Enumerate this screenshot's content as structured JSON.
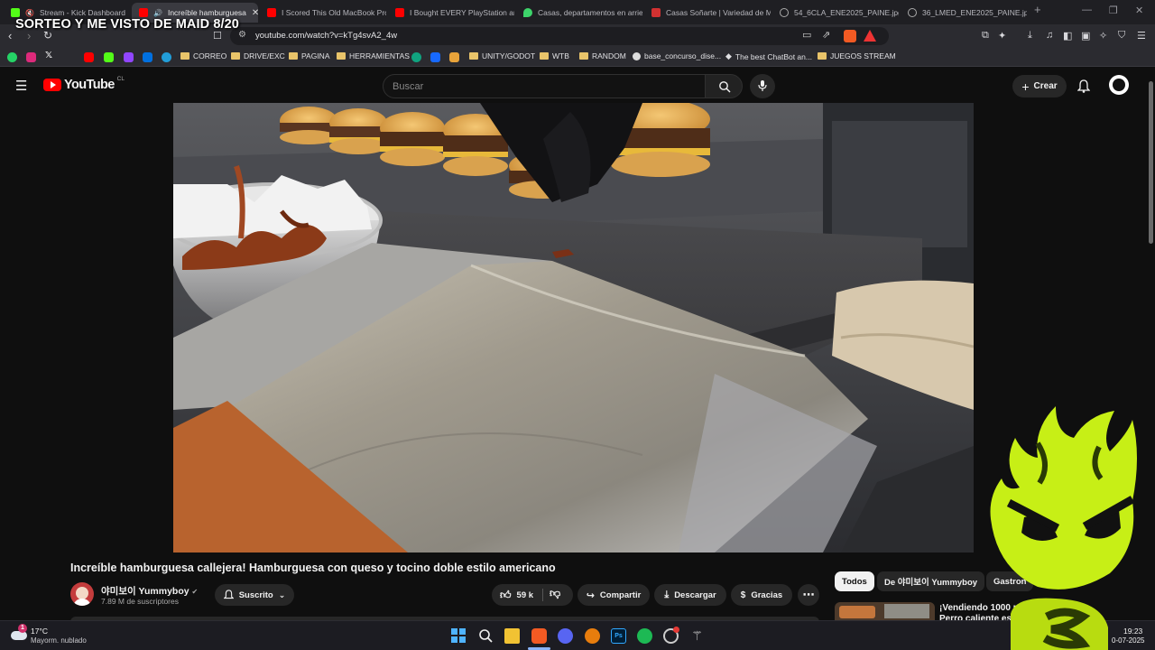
{
  "overlay": {
    "title": "SORTEO Y ME VISTO DE MAID 8/20"
  },
  "tabs": [
    {
      "label": "Stream - Kick Dashboard",
      "color": "#53fc18"
    },
    {
      "label": "Increíble hamburguesa",
      "color": "#ff0000",
      "active": true
    },
    {
      "label": "I Scored This Old MacBook Pro",
      "color": "#ff0000"
    },
    {
      "label": "I Bought EVERY PlayStation and",
      "color": "#ff0000"
    },
    {
      "label": "Casas, departamentos en arrie",
      "color": "#3dd46a"
    },
    {
      "label": "Casas Soñarte | Variedad de M",
      "color": "#d23131"
    },
    {
      "label": "54_6CLA_ENE2025_PAINE.jpg",
      "color": "#9a9aa0"
    },
    {
      "label": "36_LMED_ENE2025_PAINE.jpg",
      "color": "#9a9aa0"
    }
  ],
  "address": {
    "url": "youtube.com/watch?v=kTg4svA2_4w"
  },
  "bookmarks": [
    {
      "label": "CORREO",
      "type": "folder"
    },
    {
      "label": "DRIVE/EXC",
      "type": "folder"
    },
    {
      "label": "PAGINA",
      "type": "folder"
    },
    {
      "label": "HERRAMIENTAS",
      "type": "folder"
    },
    {
      "label": "UNITY/GODOT",
      "type": "folder"
    },
    {
      "label": "WTB",
      "type": "folder"
    },
    {
      "label": "RANDOM",
      "type": "folder"
    },
    {
      "label": "base_concurso_dise...",
      "type": "link"
    },
    {
      "label": "The best ChatBot an...",
      "type": "link"
    },
    {
      "label": "JUEGOS STREAM",
      "type": "folder"
    }
  ],
  "youtube": {
    "logo": "YouTube",
    "region": "CL",
    "search_placeholder": "Buscar",
    "create_label": "Crear"
  },
  "video": {
    "title": "Increíble hamburguesa callejera! Hamburguesa con queso y tocino doble estilo americano",
    "channel": "야미보이 Yummyboy",
    "subscribers": "7.89 M de suscriptores",
    "subscribed_label": "Suscrito",
    "likes": "59 k",
    "share_label": "Compartir",
    "download_label": "Descargar",
    "thanks_label": "Gracias"
  },
  "chips": [
    {
      "label": "Todos"
    },
    {
      "label": "De 야미보이 Yummyboy"
    },
    {
      "label": "Gastron"
    }
  ],
  "recommended": {
    "title_line1": "¡Vendiendo 1000 piez",
    "title_line2": "Perro caliente estil"
  },
  "taskbar": {
    "weather_temp": "17°C",
    "weather_desc": "Mayorm. nublado",
    "weather_badge": "1",
    "time": "19:23",
    "date": "0-07-2025"
  }
}
